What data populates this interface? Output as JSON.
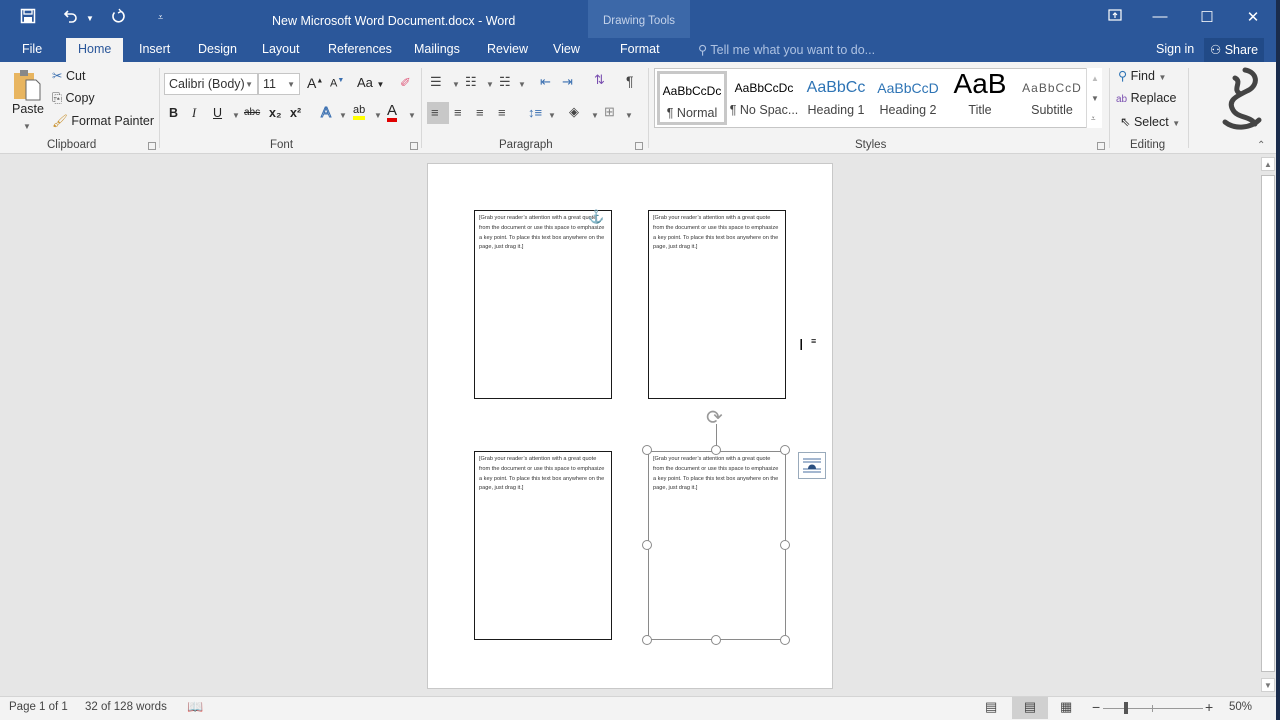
{
  "window": {
    "title": "New Microsoft Word Document.docx - Word",
    "context_tab_group": "Drawing Tools",
    "controls": {
      "ribbon_display": "ribbon-display-options-icon",
      "minimize": "—",
      "maximize": "☐",
      "close": "✕"
    }
  },
  "quick_access": {
    "save": "save-icon",
    "undo": "undo-icon",
    "redo": "redo-icon",
    "customize": "customize-qat-icon"
  },
  "tabs": [
    {
      "label": "File"
    },
    {
      "label": "Home",
      "active": true
    },
    {
      "label": "Insert"
    },
    {
      "label": "Design"
    },
    {
      "label": "Layout"
    },
    {
      "label": "References"
    },
    {
      "label": "Mailings"
    },
    {
      "label": "Review"
    },
    {
      "label": "View"
    },
    {
      "label": "Format"
    }
  ],
  "tell_me": {
    "placeholder": "Tell me what you want to do..."
  },
  "account": {
    "sign_in": "Sign in",
    "share": "Share"
  },
  "ribbon": {
    "clipboard": {
      "label": "Clipboard",
      "paste": "Paste",
      "cut": "Cut",
      "copy": "Copy",
      "format_painter": "Format Painter"
    },
    "font": {
      "label": "Font",
      "font_name": "Calibri (Body)",
      "font_size": "11",
      "grow": "A",
      "shrink": "A",
      "change_case": "Aa",
      "bold": "B",
      "italic": "I",
      "underline": "U",
      "strikethrough": "abc",
      "subscript": "x₂",
      "superscript": "x²",
      "text_effects": "A",
      "highlight": "ab",
      "font_color": "A",
      "highlight_color": "#ffff00",
      "font_color_value": "#e00000"
    },
    "paragraph": {
      "label": "Paragraph"
    },
    "styles": {
      "label": "Styles",
      "items": [
        {
          "preview": "AaBbCcDc",
          "name": "¶ Normal",
          "selected": true
        },
        {
          "preview": "AaBbCcDc",
          "name": "¶ No Spac..."
        },
        {
          "preview": "AaBbCc",
          "name": "Heading 1"
        },
        {
          "preview": "AaBbCcD",
          "name": "Heading 2"
        },
        {
          "preview": "AaB",
          "name": "Title"
        },
        {
          "preview": "AaBbCcD",
          "name": "Subtitle"
        }
      ]
    },
    "editing": {
      "label": "Editing",
      "find": "Find",
      "replace": "Replace",
      "select": "Select"
    }
  },
  "document": {
    "text_boxes": [
      {
        "text": "[Grab your reader’s attention with a great quote from the document or use this space to emphasize a key point. To place this text box anywhere on the page, just drag it.]"
      },
      {
        "text": "[Grab your reader’s attention with a great quote from the document or use this space to emphasize a key point. To place this text box anywhere on the page, just drag it.]"
      },
      {
        "text": "[Grab your reader’s attention with a great quote from the document or use this space to emphasize a key point. To place this text box anywhere on the page, just drag it.]"
      },
      {
        "text": "[Grab your reader’s attention with a great quote from the document or use this space to emphasize a key point. To place this text box anywhere on the page, just drag it.]",
        "selected": true
      }
    ]
  },
  "status": {
    "page": "Page 1 of 1",
    "words": "32 of 128 words",
    "zoom": "50%",
    "zoom_minus": "−",
    "zoom_plus": "+"
  }
}
